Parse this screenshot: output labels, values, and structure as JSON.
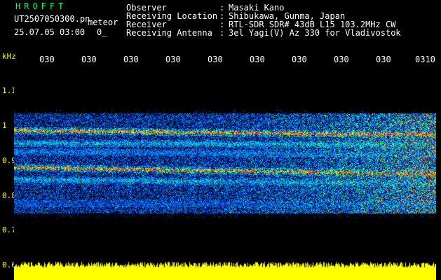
{
  "header": {
    "app_name": "HROFFT",
    "file_name": "UT2507050300.pn",
    "file_kind": "meteor",
    "date_time": "25.07.05 03:00",
    "count": "0_",
    "rows": [
      {
        "label": "Observer",
        "value": "Masaki Kano"
      },
      {
        "label": "Receiving Location",
        "value": "Shibukawa, Gunma, Japan"
      },
      {
        "label": "Receiver",
        "value": "RTL-SDR SDR# 43dB L15 103.2MHz CW"
      },
      {
        "label": "Receiving Antenna",
        "value": "3el Yagi(V) Az 330 for Vladivostok"
      }
    ]
  },
  "axes": {
    "y_unit": "kHz",
    "y_ticks": [
      "1.1",
      "1",
      "0.9",
      "0.8",
      "0.7",
      "0.6"
    ],
    "x_ticks": [
      "030",
      "030",
      "030",
      "030",
      "030",
      "030",
      "030",
      "030",
      "030",
      "0310"
    ]
  },
  "colors": {
    "text": "#ffffff",
    "accent_green": "#00ff66",
    "tick_yellow": "#ffff00",
    "noise_strip": "#ffff00",
    "background": "#000000"
  }
}
